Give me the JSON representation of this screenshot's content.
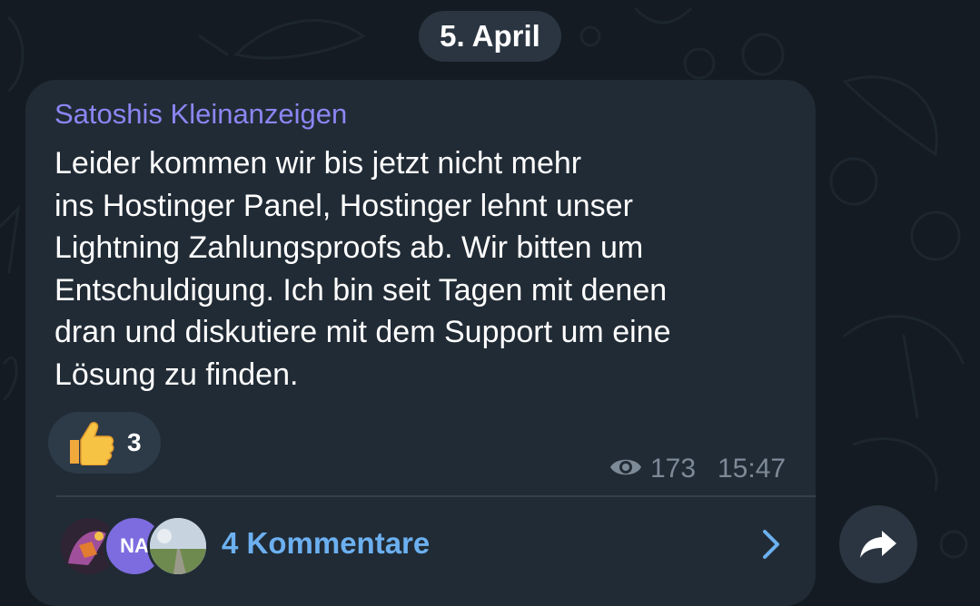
{
  "date_chip": "5. April",
  "message": {
    "sender": "Satoshis Kleinanzeigen",
    "text": "Leider kommen wir bis jetzt nicht mehr\nins Hostinger Panel, Hostinger lehnt unser\nLightning Zahlungsproofs ab. Wir bitten um\nEntschuldigung. Ich bin seit Tagen mit denen\ndran und diskutiere mit dem Support um eine\nLösung zu finden.",
    "reaction": {
      "icon": "thumbs-up-icon",
      "count": "3"
    },
    "views": "173",
    "time": "15:47"
  },
  "comments": {
    "avatars": [
      {
        "name": "avatar-1",
        "initials": ""
      },
      {
        "name": "avatar-2",
        "initials": "NA"
      },
      {
        "name": "avatar-3",
        "initials": ""
      }
    ],
    "label": "4 Kommentare"
  },
  "colors": {
    "background": "#141b22",
    "bubble": "#212b35",
    "sender": "#8b86f3",
    "link": "#6cb0f0",
    "meta": "#7d8a97"
  }
}
